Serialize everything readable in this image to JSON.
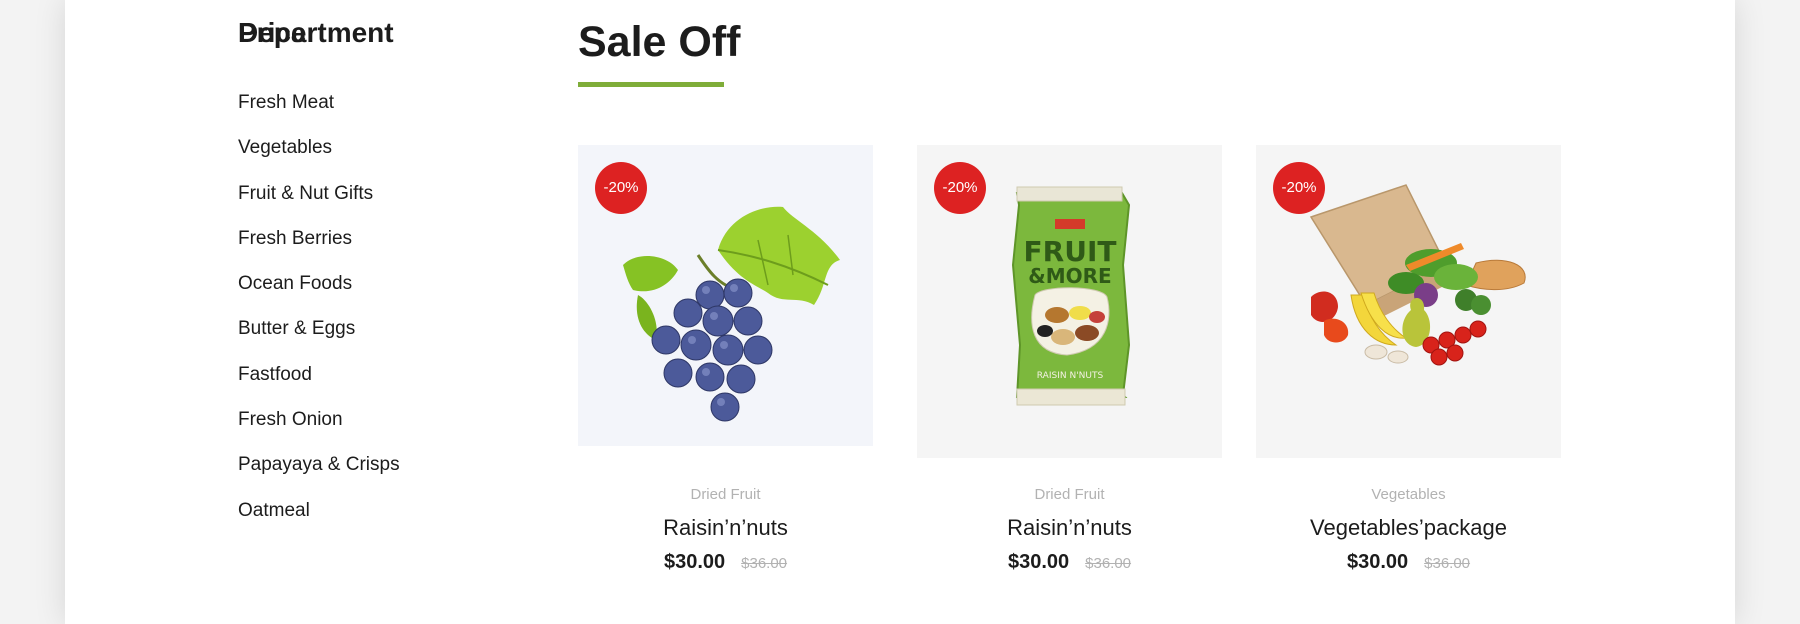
{
  "sidebar": {
    "department_title": "Department",
    "departments": [
      "Fresh Meat",
      "Vegetables",
      "Fruit & Nut Gifts",
      "Fresh Berries",
      "Ocean Foods",
      "Butter & Eggs",
      "Fastfood",
      "Fresh Onion",
      "Papayaya & Crisps",
      "Oatmeal"
    ],
    "price_title": "Price"
  },
  "main": {
    "section_title": "Sale Off",
    "products": [
      {
        "discount": "-20%",
        "category": "Dried Fruit",
        "name": "Raisin’n’nuts",
        "price": "$30.00",
        "old_price": "$36.00",
        "image": "grapes-image"
      },
      {
        "discount": "-20%",
        "category": "Dried Fruit",
        "name": "Raisin’n’nuts",
        "price": "$30.00",
        "old_price": "$36.00",
        "image": "fruit-and-more-bag-image"
      },
      {
        "discount": "-20%",
        "category": "Vegetables",
        "name": "Vegetables’package",
        "price": "$30.00",
        "old_price": "$36.00",
        "image": "vegetable-bag-image"
      }
    ]
  },
  "colors": {
    "accent_green": "#7fad39",
    "badge_red": "#dd2222",
    "muted_text": "#b2b2b2"
  }
}
